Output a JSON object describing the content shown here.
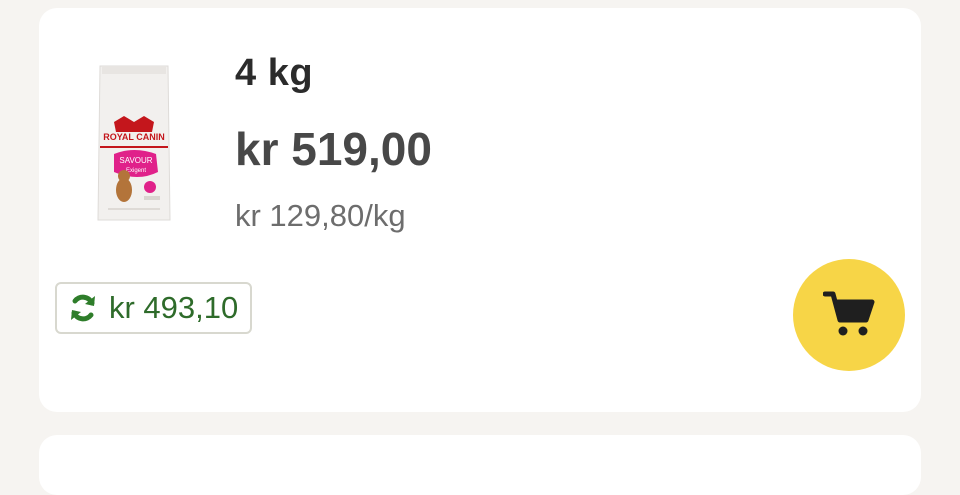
{
  "product": {
    "brand_logo_text": "ROYAL CANIN",
    "package_line1": "SAVOUR",
    "package_line2": "Exigent",
    "weight": "4 kg",
    "price": "kr 519,00",
    "unit_price": "kr 129,80/kg"
  },
  "subscription": {
    "price": "kr 493,10",
    "icon": "refresh-icon"
  },
  "cart": {
    "icon": "shopping-cart-icon"
  },
  "colors": {
    "background": "#f6f4f1",
    "card": "#ffffff",
    "cart_button": "#f7d547",
    "subscription_green": "#2e6b2a"
  }
}
